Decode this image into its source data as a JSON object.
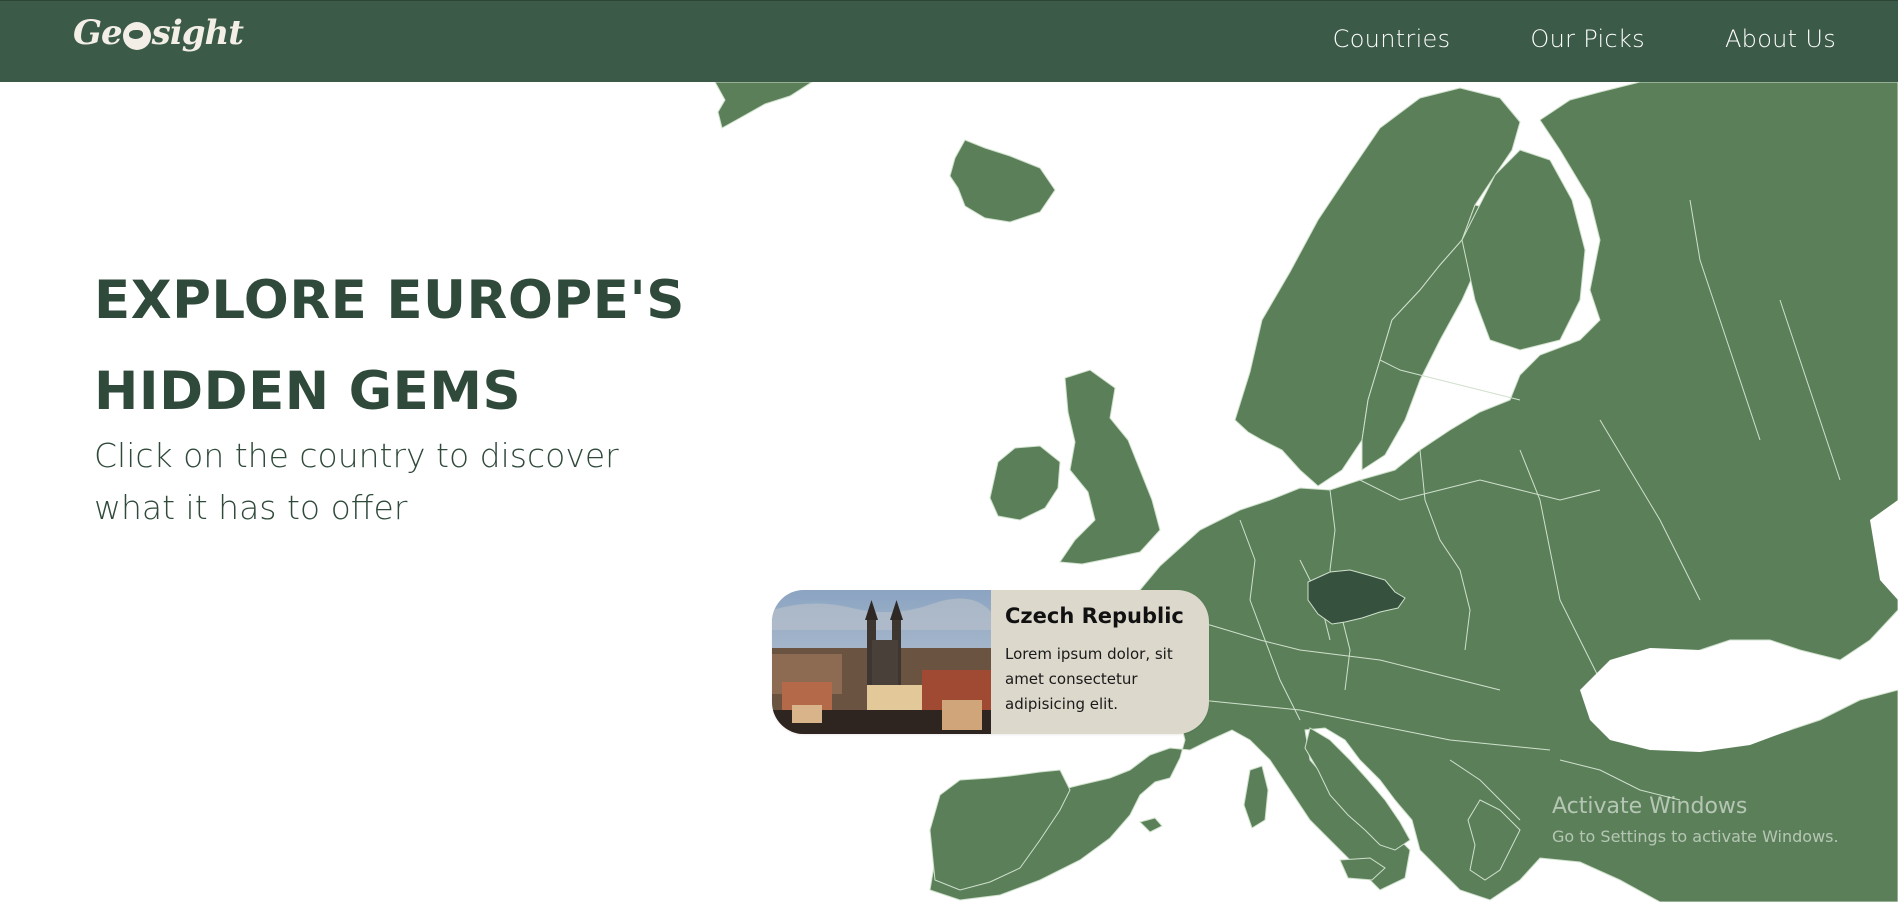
{
  "nav": {
    "logo_text_left": "Ge",
    "logo_text_right": "sight",
    "links": [
      "Countries",
      "Our Picks",
      "About Us"
    ]
  },
  "hero": {
    "title_line1": "EXPLORE EUROPE'S",
    "title_line2": "HIDDEN GEMS",
    "subtitle_line1": "Click on the country to discover",
    "subtitle_line2": "what it has to offer"
  },
  "map": {
    "land_color": "#5b8059",
    "border_color": "#cfe0cc",
    "highlight_color": "#36523f",
    "highlighted_country": "Czech Republic"
  },
  "card": {
    "title": "Czech Republic",
    "text": "Lorem ipsum dolor, sit amet consectetur adipisicing elit.",
    "background": "#dcd8cc"
  },
  "watermark": {
    "title": "Activate Windows",
    "subtitle": "Go to Settings to activate Windows."
  },
  "colors": {
    "navbar": "#3b5a47",
    "heading": "#2f4a3a"
  }
}
